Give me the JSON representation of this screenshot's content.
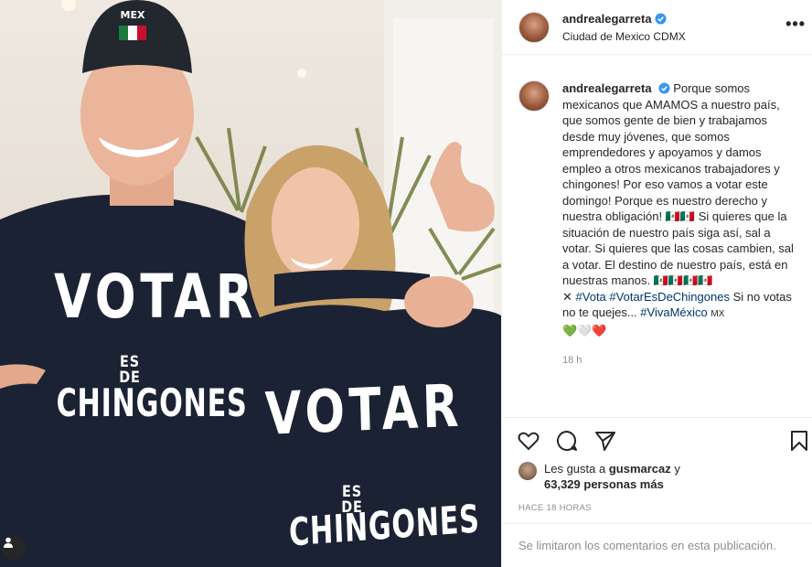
{
  "photo": {
    "cap_label": "MEX",
    "shirt1": {
      "line1": "VOTAR",
      "line2": "ES DE",
      "line3": "CHINGONES"
    },
    "shirt2": {
      "line1": "VOTAR",
      "line2": "ES DE",
      "line3": "CHINGONES"
    }
  },
  "header": {
    "username": "andrealegarreta",
    "location": "Ciudad de Mexico CDMX",
    "more": "•••"
  },
  "caption": {
    "username": "andrealegarreta",
    "text": "Porque somos mexicanos que AMAMOS a nuestro país, que somos gente de bien y trabajamos desde muy jóvenes, que somos emprendedores y apoyamos y damos empleo a otros mexicanos trabajadores y chingones! Por eso vamos a votar este domingo! Porque es nuestro derecho y nuestra obligación! 🇲🇽🇲🇽 Si quieres que la situación de nuestro país siga así, sal a votar. Si quieres que las cosas cambien, sal a votar. El destino de nuestro país, está en nuestras manos. 🇲🇽🇲🇽🇲🇽🇲🇽",
    "prefix": "✕",
    "tags": [
      "#Vota",
      "#VotarEsDeChingones"
    ],
    "after_tags": "Si no votas no te quejes...",
    "tag_last": "#VivaMéxico",
    "flag": "MX",
    "hearts": "💚🤍❤️",
    "time": "18 h"
  },
  "likes": {
    "prefix": "Les gusta a",
    "user": "gusmarcaz",
    "conj": "y",
    "count": "63,329 personas más"
  },
  "posted_ago": "HACE 18 HORAS",
  "comments_notice": "Se limitaron los comentarios en esta publicación.",
  "colors": {
    "hashtag": "#00376b",
    "verified": "#3897f0",
    "muted": "#8e8e8e",
    "heart_red": "#ed4956"
  },
  "icons": [
    "heart-icon",
    "comment-icon",
    "share-icon",
    "bookmark-icon",
    "verified-icon",
    "more-icon",
    "user-tag-icon"
  ]
}
